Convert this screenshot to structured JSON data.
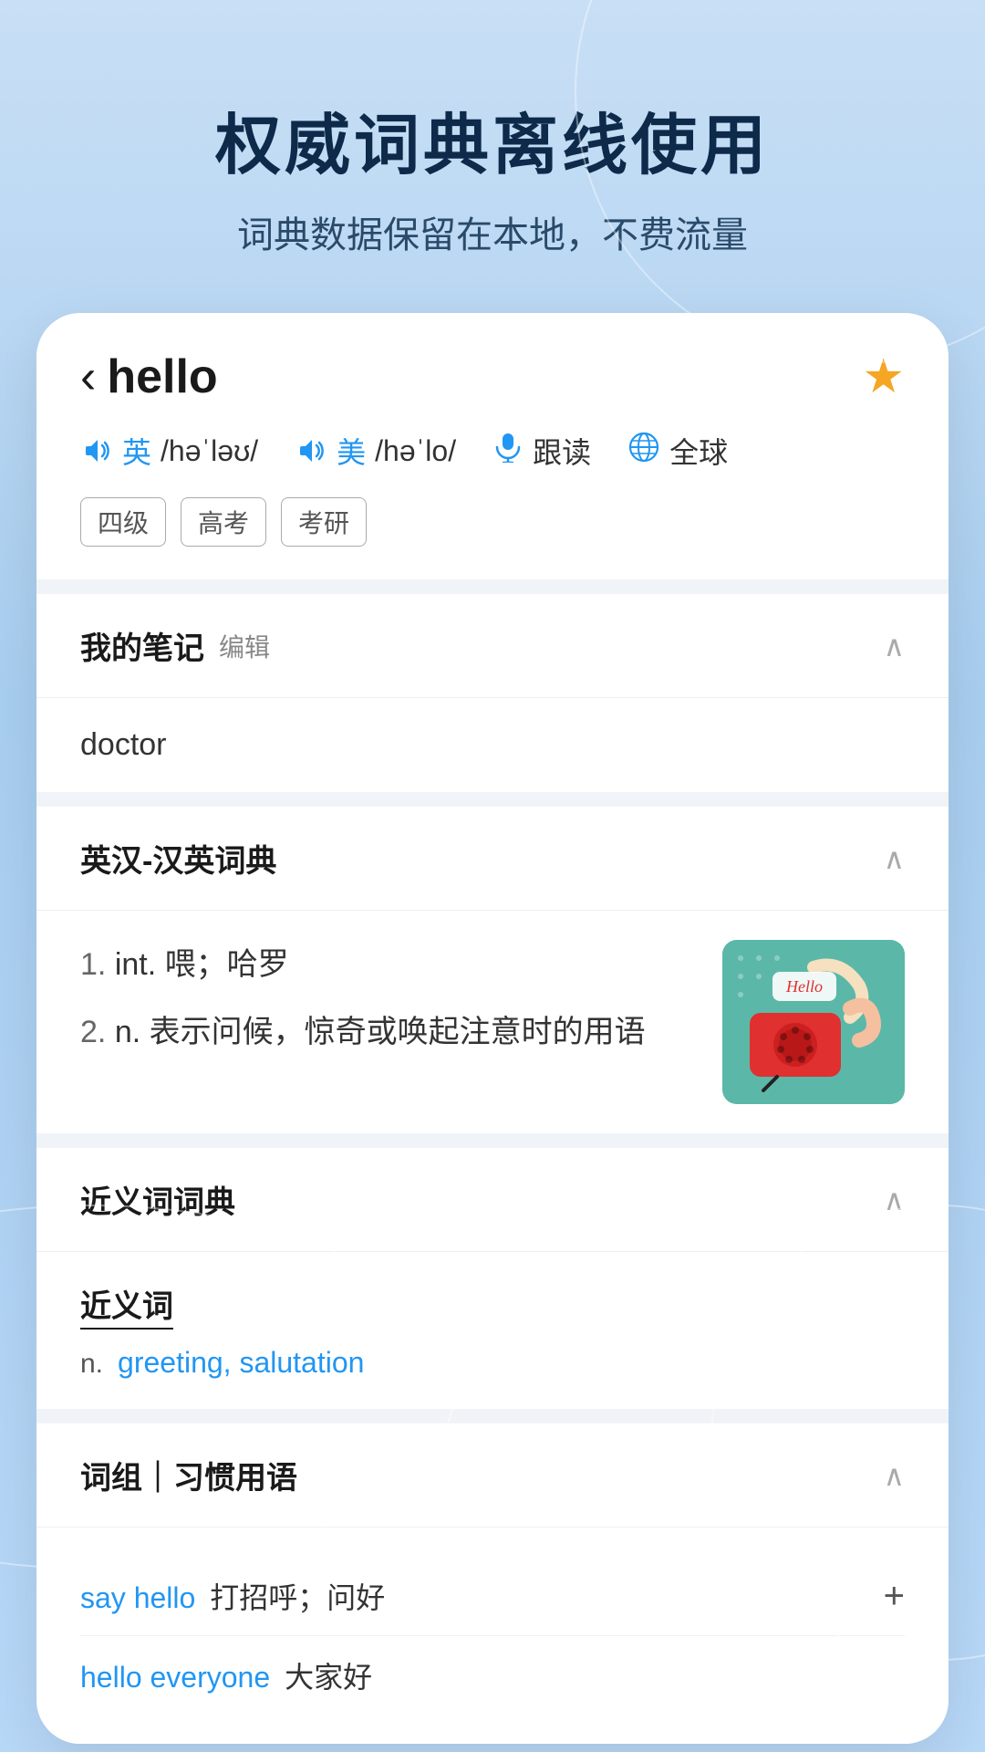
{
  "header": {
    "title": "权威词典离线使用",
    "subtitle": "词典数据保留在本地，不费流量"
  },
  "word": {
    "back_arrow": "‹",
    "word_text": "hello",
    "star": "★",
    "pronunciations": [
      {
        "lang": "英",
        "phonetic": "/həˈləʊ/"
      },
      {
        "lang": "美",
        "phonetic": "/həˈlo/"
      }
    ],
    "actions": [
      {
        "label": "跟读"
      },
      {
        "label": "全球"
      }
    ],
    "tags": [
      "四级",
      "高考",
      "考研"
    ]
  },
  "notes_section": {
    "title": "我的笔记",
    "edit_label": "编辑",
    "content": "doctor"
  },
  "dict_section": {
    "title": "英汉-汉英词典",
    "definitions": [
      {
        "num": "1.",
        "pos": "int.",
        "text": "喂；哈罗"
      },
      {
        "num": "2.",
        "pos": "n.",
        "text": "表示问候，惊奇或唤起注意时的用语"
      }
    ]
  },
  "synonym_section": {
    "title": "近义词词典",
    "synonym_label": "近义词",
    "pos": "n.",
    "synonyms": "greeting, salutation"
  },
  "phrase_section": {
    "title": "词组｜习惯用语",
    "phrases": [
      {
        "word": "say hello",
        "meaning": "打招呼；问好"
      },
      {
        "word": "hello everyone",
        "meaning": "大家好"
      }
    ]
  }
}
